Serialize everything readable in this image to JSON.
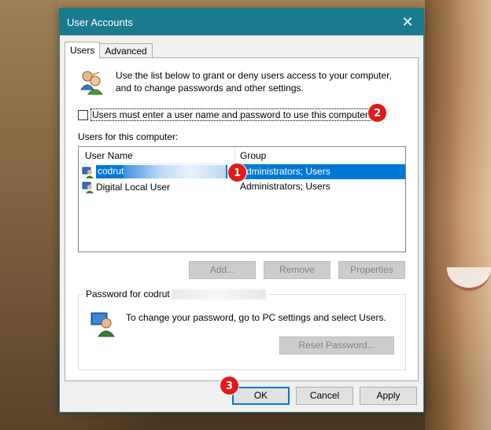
{
  "window": {
    "title": "User Accounts",
    "close_glyph": "✕"
  },
  "tabs": [
    {
      "label": "Users",
      "active": true
    },
    {
      "label": "Advanced",
      "active": false
    }
  ],
  "intro": {
    "icon": "users-icon",
    "text": "Use the list below to grant or deny users access to your computer, and to change passwords and other settings."
  },
  "checkbox": {
    "label": "Users must enter a user name and password to use this computer.",
    "checked": false
  },
  "users_list": {
    "label": "Users for this computer:",
    "columns": [
      "User Name",
      "Group"
    ],
    "rows": [
      {
        "name": "codrut",
        "group": "Administrators; Users",
        "selected": true,
        "redacted": true
      },
      {
        "name": "Digital Local User",
        "group": "Administrators; Users",
        "selected": false,
        "redacted": false
      }
    ]
  },
  "actions": {
    "add": "Add...",
    "remove": "Remove",
    "properties": "Properties"
  },
  "password_group": {
    "title": "Password for codrut",
    "text": "To change your password, go to PC settings and select Users.",
    "reset_button": "Reset Password..."
  },
  "footer": {
    "ok": "OK",
    "cancel": "Cancel",
    "apply": "Apply"
  },
  "markers": [
    "1",
    "2",
    "3"
  ],
  "colors": {
    "titlebar": "#1b7b8e",
    "selection": "#0078d7",
    "marker": "#e11a1a"
  }
}
